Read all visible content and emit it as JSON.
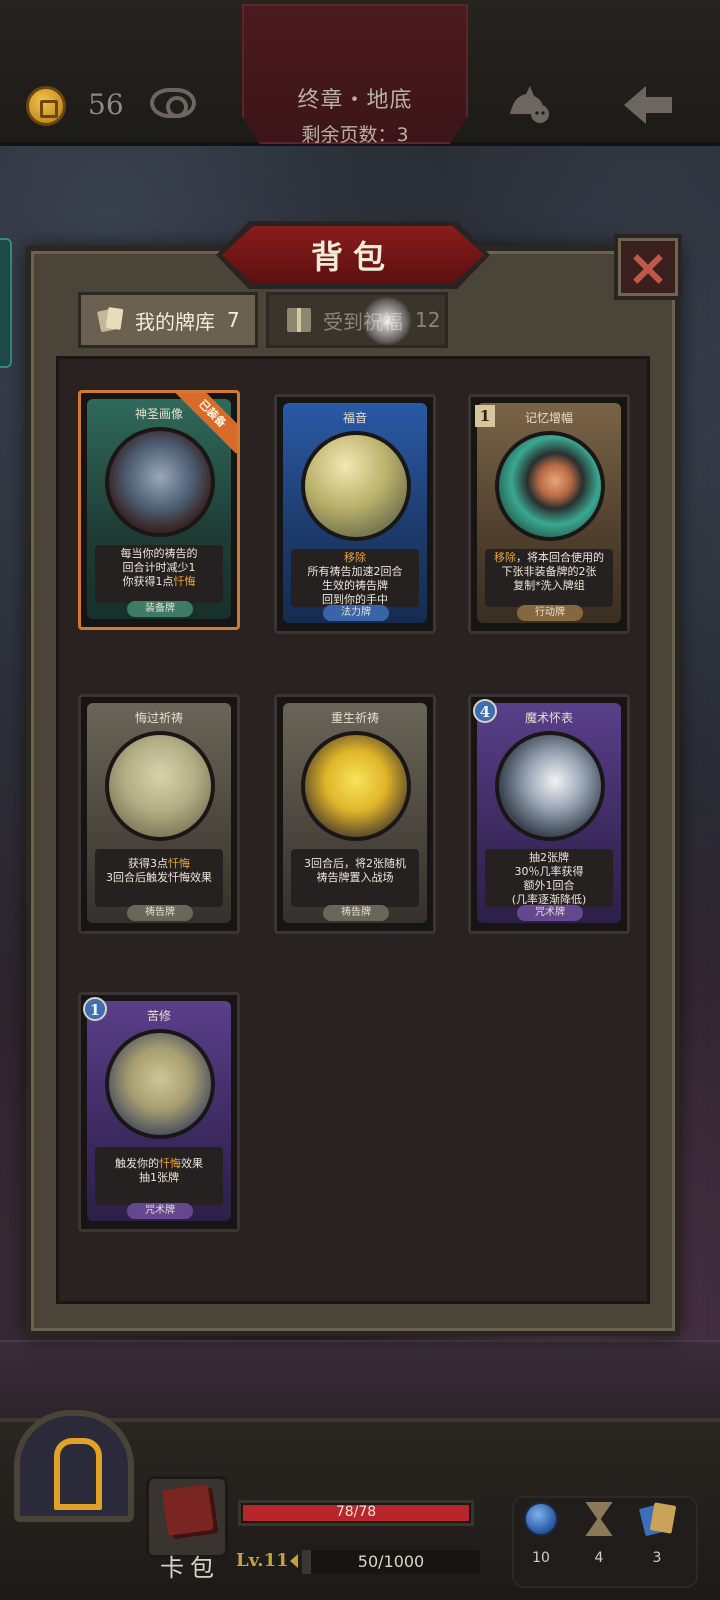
{
  "topbar": {
    "coins": "56",
    "chapter_title": "终章・地底",
    "pages_left": "剩余页数：3"
  },
  "panel": {
    "title": "背包",
    "tabs": [
      {
        "label": "我的牌库",
        "count": "7",
        "selected": true
      },
      {
        "label": "受到祝福",
        "count": "12",
        "selected": false
      }
    ]
  },
  "cards": [
    {
      "name": "神圣画像",
      "cost": "",
      "equipped_label": "已装备",
      "desc_pre": "每当你的祷告的\n回合计时减少1\n你获得1点",
      "desc_hl": "忏悔",
      "desc_post": "",
      "type": "装备牌",
      "theme": "green"
    },
    {
      "name": "福音",
      "cost": "",
      "equipped_label": "",
      "desc_pre": "",
      "desc_hl": "移除",
      "desc_post": "\n所有祷告加速2回合\n生效的祷告牌\n回到你的手中",
      "type": "法力牌",
      "theme": "blue"
    },
    {
      "name": "记忆增幅",
      "cost": "1",
      "equipped_label": "",
      "desc_pre": "",
      "desc_hl": "移除",
      "desc_post": "，将本回合使用的\n下张非装备牌的2张\n复制*洗入牌组",
      "type": "行动牌",
      "theme": "brown"
    },
    {
      "name": "悔过祈祷",
      "cost": "",
      "equipped_label": "",
      "desc_pre": "获得3点",
      "desc_hl": "忏悔",
      "desc_post": "\n3回合后触发忏悔效果",
      "type": "祷告牌",
      "theme": "gray"
    },
    {
      "name": "重生祈祷",
      "cost": "",
      "equipped_label": "",
      "desc_pre": "3回合后，将2张随机\n祷告牌置入战场",
      "desc_hl": "",
      "desc_post": "",
      "type": "祷告牌",
      "theme": "gray"
    },
    {
      "name": "魔术怀表",
      "cost": "4",
      "equipped_label": "",
      "desc_pre": "抽2张牌\n30％几率获得\n额外1回合\n(几率逐渐降低)",
      "desc_hl": "",
      "desc_post": "",
      "type": "咒术牌",
      "theme": "purple"
    },
    {
      "name": "苦修",
      "cost": "1",
      "equipped_label": "",
      "desc_pre": "触发你的",
      "desc_hl": "忏悔",
      "desc_post": "效果\n抽1张牌",
      "type": "咒术牌",
      "theme": "purple"
    }
  ],
  "bottombar": {
    "card_bag_label": "卡包",
    "hp": "78/78",
    "hp_fraction": 1.0,
    "level": "Lv.11",
    "xp": "50/1000",
    "xp_fraction": 0.05,
    "stats": [
      {
        "icon": "mana-orb-icon",
        "value": "10"
      },
      {
        "icon": "hourglass-icon",
        "value": "4"
      },
      {
        "icon": "cards-icon",
        "value": "3"
      }
    ]
  },
  "colors": {
    "highlight": "#eaa53a",
    "banner_red": "#8a1c1c",
    "hp_red": "#b7262a"
  }
}
